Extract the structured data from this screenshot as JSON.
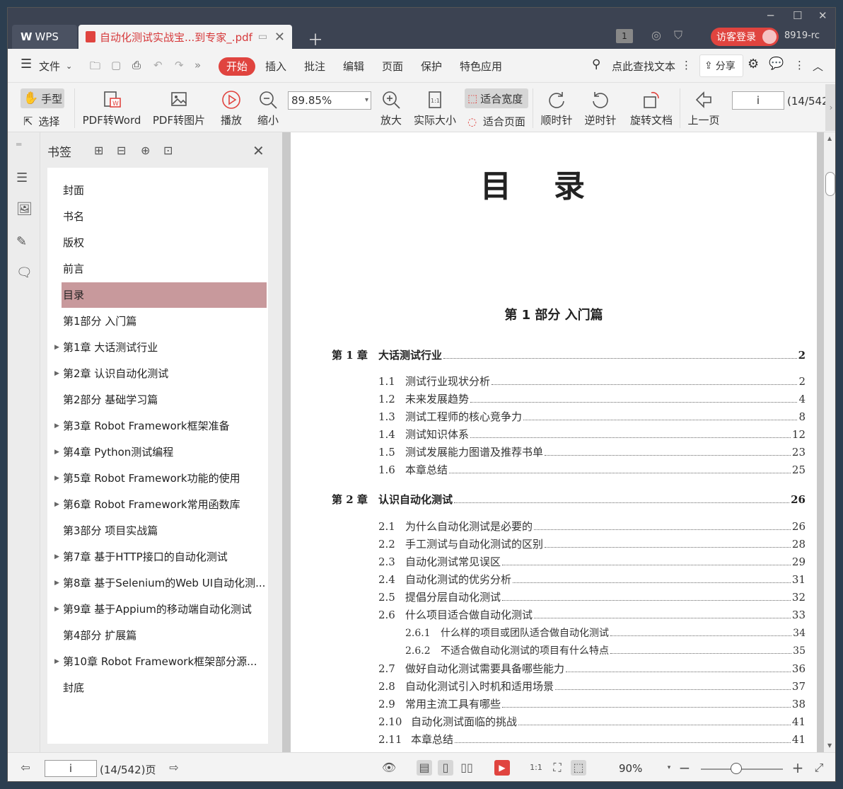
{
  "titlebar": {
    "app_tab": "WPS",
    "doc_tab": "自动化测试实战宝...到专家_.pdf",
    "badge": "1",
    "login": "访客登录",
    "user": "8919-rc"
  },
  "menu": {
    "file": "文件",
    "items": [
      "开始",
      "插入",
      "批注",
      "编辑",
      "页面",
      "保护",
      "特色应用"
    ],
    "search": "点此查找文本",
    "share": "分享"
  },
  "toolbar": {
    "hand": "手型",
    "select": "选择",
    "pdf_word": "PDF转Word",
    "pdf_img": "PDF转图片",
    "play": "播放",
    "zoom_out": "缩小",
    "zoom_value": "89.85%",
    "zoom_in": "放大",
    "actual": "实际大小",
    "fit_width": "适合宽度",
    "fit_page": "适合页面",
    "cw": "顺时针",
    "ccw": "逆时针",
    "rotate": "旋转文档",
    "prev": "上一页",
    "page": "i",
    "page_total": "(14/542"
  },
  "panel": {
    "title": "书签",
    "bookmarks": [
      {
        "label": "封面",
        "expand": false
      },
      {
        "label": "书名",
        "expand": false
      },
      {
        "label": "版权",
        "expand": false
      },
      {
        "label": "前言",
        "expand": false
      },
      {
        "label": "目录",
        "expand": false,
        "selected": true
      },
      {
        "label": "第1部分  入门篇",
        "expand": false
      },
      {
        "label": "第1章  大话测试行业",
        "expand": true
      },
      {
        "label": "第2章  认识自动化测试",
        "expand": true
      },
      {
        "label": "第2部分  基础学习篇",
        "expand": false
      },
      {
        "label": "第3章  Robot Framework框架准备",
        "expand": true
      },
      {
        "label": "第4章  Python测试编程",
        "expand": true
      },
      {
        "label": "第5章  Robot Framework功能的使用",
        "expand": true
      },
      {
        "label": "第6章  Robot Framework常用函数库",
        "expand": true
      },
      {
        "label": "第3部分  项目实战篇",
        "expand": false
      },
      {
        "label": "第7章  基于HTTP接口的自动化测试",
        "expand": true
      },
      {
        "label": "第8章  基于Selenium的Web UI自动化测...",
        "expand": true
      },
      {
        "label": "第9章  基于Appium的移动端自动化测试",
        "expand": true
      },
      {
        "label": "第4部分  扩展篇",
        "expand": false
      },
      {
        "label": "第10章  Robot Framework框架部分源...",
        "expand": true
      },
      {
        "label": "封底",
        "expand": false
      }
    ]
  },
  "document": {
    "title": "目录",
    "part": "第 1 部分    入门篇",
    "toc": [
      {
        "level": "chap",
        "num": "第 1 章",
        "text": "大话测试行业",
        "page": "2"
      },
      {
        "level": "sec",
        "num": "1.1",
        "text": "测试行业现状分析",
        "page": "2"
      },
      {
        "level": "sec",
        "num": "1.2",
        "text": "未来发展趋势",
        "page": "4"
      },
      {
        "level": "sec",
        "num": "1.3",
        "text": "测试工程师的核心竞争力",
        "page": "8"
      },
      {
        "level": "sec",
        "num": "1.4",
        "text": "测试知识体系",
        "page": "12"
      },
      {
        "level": "sec",
        "num": "1.5",
        "text": "测试发展能力图谱及推荐书单",
        "page": "23"
      },
      {
        "level": "sec",
        "num": "1.6",
        "text": "本章总结",
        "page": "25"
      },
      {
        "level": "chap",
        "num": "第 2 章",
        "text": "认识自动化测试",
        "page": "26"
      },
      {
        "level": "sec",
        "num": "2.1",
        "text": "为什么自动化测试是必要的",
        "page": "26"
      },
      {
        "level": "sec",
        "num": "2.2",
        "text": "手工测试与自动化测试的区别",
        "page": "28"
      },
      {
        "level": "sec",
        "num": "2.3",
        "text": "自动化测试常见误区",
        "page": "29"
      },
      {
        "level": "sec",
        "num": "2.4",
        "text": "自动化测试的优劣分析",
        "page": "31"
      },
      {
        "level": "sec",
        "num": "2.5",
        "text": "提倡分层自动化测试",
        "page": "32"
      },
      {
        "level": "sec",
        "num": "2.6",
        "text": "什么项目适合做自动化测试",
        "page": "33"
      },
      {
        "level": "subsec",
        "num": "2.6.1",
        "text": "什么样的项目或团队适合做自动化测试",
        "page": "34"
      },
      {
        "level": "subsec",
        "num": "2.6.2",
        "text": "不适合做自动化测试的项目有什么特点",
        "page": "35"
      },
      {
        "level": "sec",
        "num": "2.7",
        "text": "做好自动化测试需要具备哪些能力",
        "page": "36"
      },
      {
        "level": "sec",
        "num": "2.8",
        "text": "自动化测试引入时机和适用场景",
        "page": "37"
      },
      {
        "level": "sec",
        "num": "2.9",
        "text": "常用主流工具有哪些",
        "page": "38"
      },
      {
        "level": "sec",
        "num": "2.10",
        "text": "自动化测试面临的挑战",
        "page": "41"
      },
      {
        "level": "sec",
        "num": "2.11",
        "text": "本章总结",
        "page": "41"
      }
    ]
  },
  "status": {
    "page": "i",
    "page_total": "(14/542)页",
    "zoom": "90%"
  }
}
